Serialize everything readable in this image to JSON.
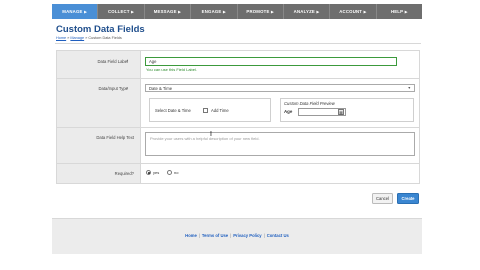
{
  "nav": {
    "items": [
      {
        "label": "MANAGE"
      },
      {
        "label": "COLLECT"
      },
      {
        "label": "MESSAGE"
      },
      {
        "label": "ENGAGE"
      },
      {
        "label": "PROMOTE"
      },
      {
        "label": "ANALYZE"
      },
      {
        "label": "ACCOUNT"
      },
      {
        "label": "HELP"
      }
    ],
    "active_color": "#4a8fd6",
    "bar_color": "#6e6e6e"
  },
  "page": {
    "title": "Custom Data Fields",
    "breadcrumb": {
      "home": "Home",
      "sep": "»",
      "manage": "Manage",
      "current": "Custom Data Fields"
    }
  },
  "form": {
    "field_label": {
      "label": "Data Field Label",
      "value": "Age",
      "hint": "You can use this Field Label."
    },
    "input_type": {
      "label": "Data/Input Type",
      "selected": "Date & Time",
      "select_text": "Select Date & Time",
      "add_time_label": "Add Time",
      "preview_title": "Custom Data Field Preview",
      "preview_label": "Age"
    },
    "help_text": {
      "label": "Data Field Help Text",
      "placeholder": "Provide your users with a helpful description of your new field."
    },
    "required": {
      "label": "Required?",
      "options": [
        {
          "label": "yes"
        },
        {
          "label": "no"
        }
      ]
    }
  },
  "actions": {
    "cancel": "Cancel",
    "create": "Create"
  },
  "footer": {
    "links": [
      {
        "label": "Home"
      },
      {
        "label": "Terms of Use"
      },
      {
        "label": "Privacy Policy"
      },
      {
        "label": "Contact Us"
      }
    ],
    "separator": "|"
  },
  "colors": {
    "accent": "#1f4e8c",
    "link": "#1f5fbf",
    "success": "#2a8a2a",
    "primary_button": "#3a86d1"
  }
}
